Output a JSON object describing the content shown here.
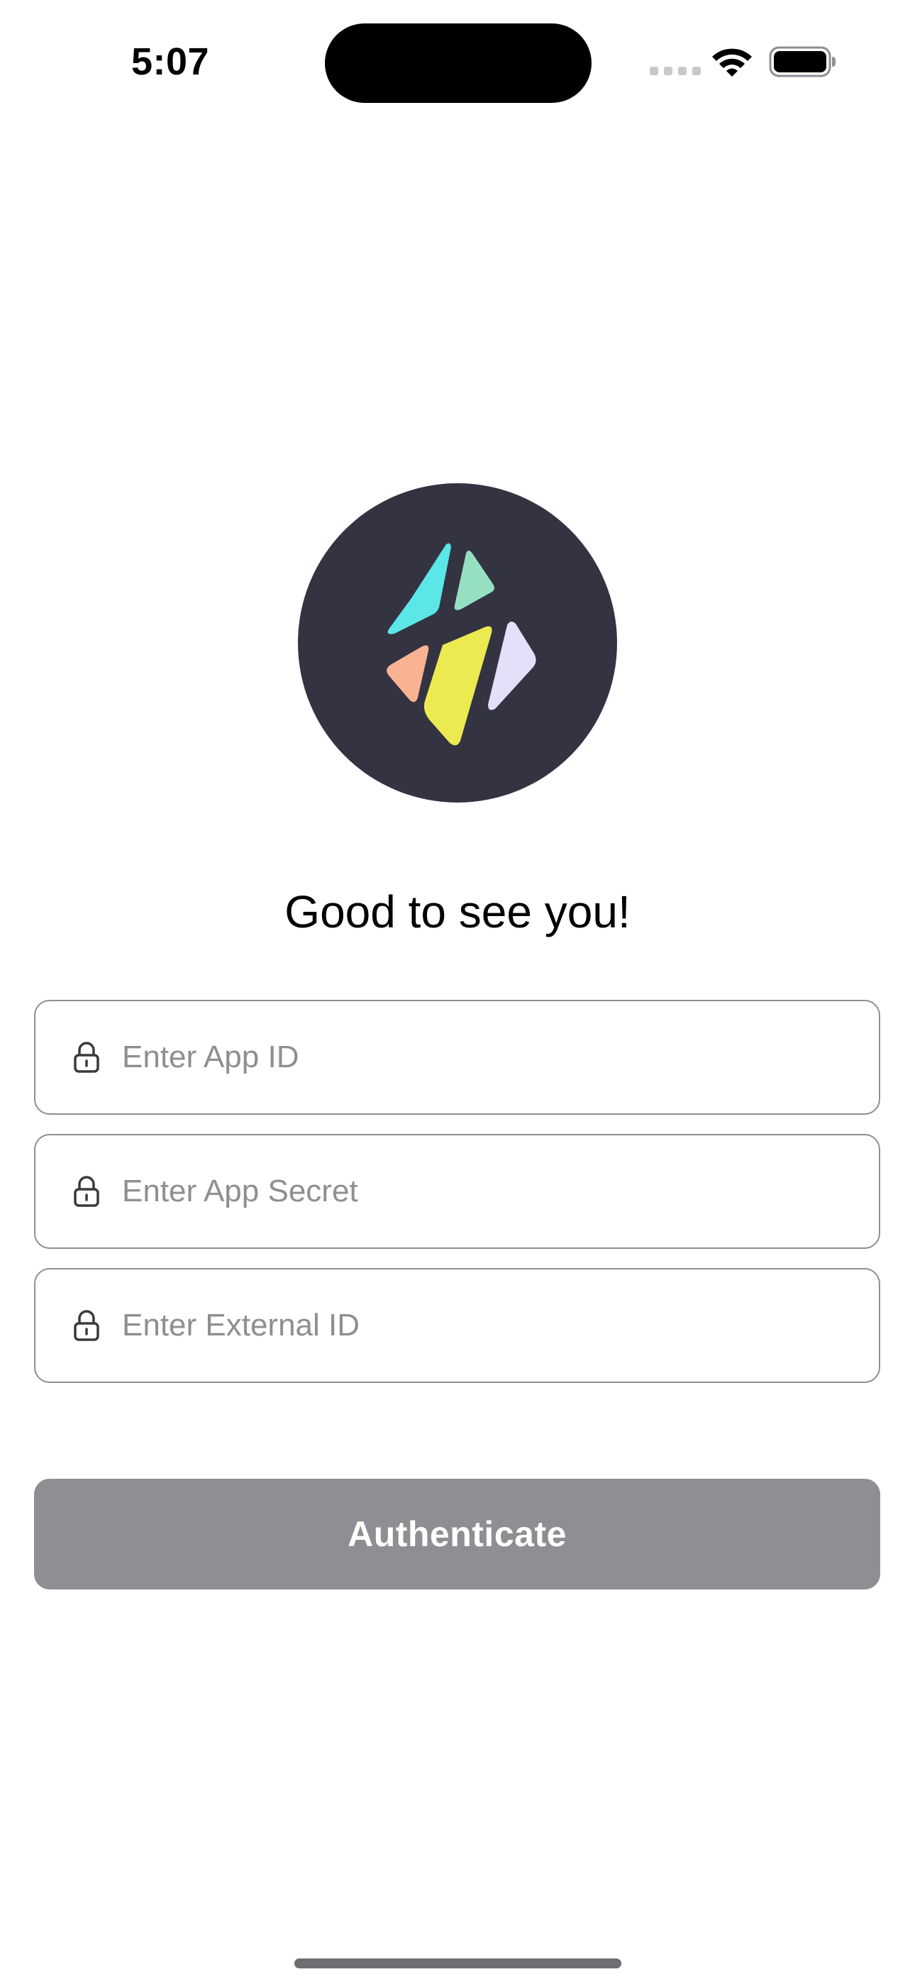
{
  "status_bar": {
    "time": "5:07",
    "icons": [
      "cellular-signal-icon",
      "wifi-icon",
      "battery-icon"
    ]
  },
  "logo": {
    "icon": "app-logo-icon",
    "background_color": "#343342",
    "shard_colors": [
      "#5be6e8",
      "#96e0c2",
      "#f9b393",
      "#ebea50",
      "#e4e0f9"
    ]
  },
  "greeting": "Good to see you!",
  "form": {
    "app_id": {
      "placeholder": "Enter App ID",
      "value": "",
      "icon": "lock-icon"
    },
    "app_secret": {
      "placeholder": "Enter App Secret",
      "value": "",
      "icon": "lock-icon"
    },
    "external_id": {
      "placeholder": "Enter External ID",
      "value": "",
      "icon": "lock-icon"
    }
  },
  "authenticate_button": {
    "label": "Authenticate",
    "color": "#8e8e93",
    "state": "disabled"
  }
}
